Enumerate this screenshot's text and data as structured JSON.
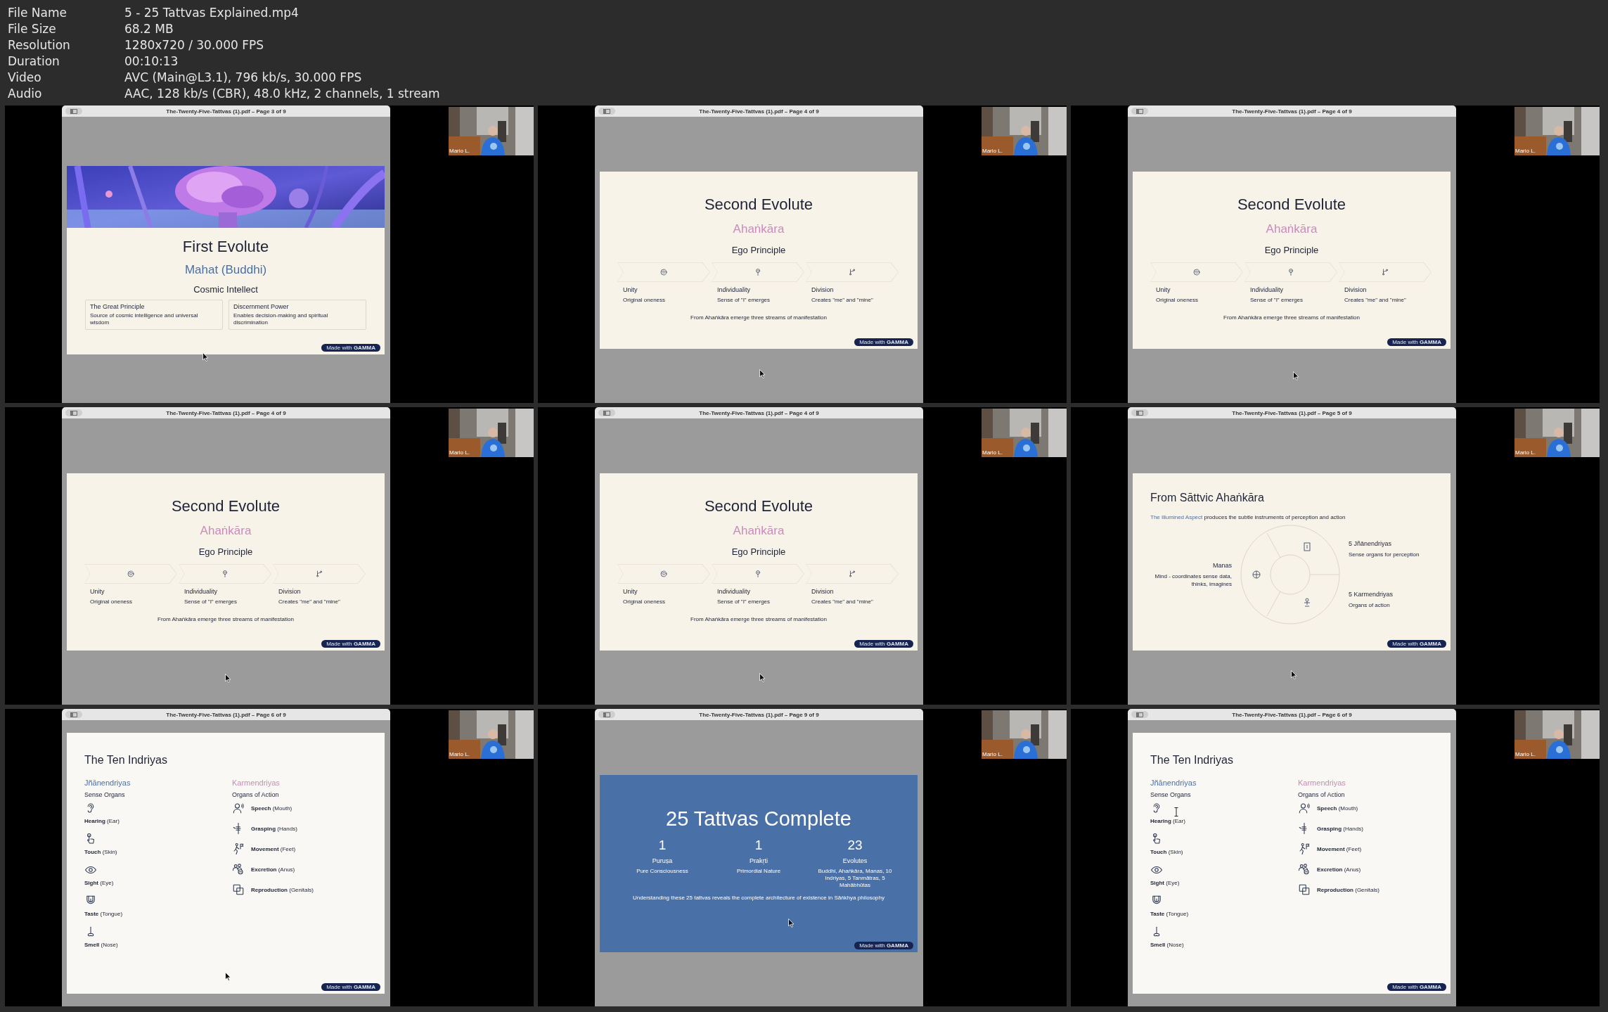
{
  "header": {
    "fields": [
      {
        "label": "File Name",
        "value": "5 - 25 Tattvas Explained.mp4"
      },
      {
        "label": "File Size",
        "value": "68.2 MB"
      },
      {
        "label": "Resolution",
        "value": "1280x720 / 30.000 FPS"
      },
      {
        "label": "Duration",
        "value": "00:10:13"
      },
      {
        "label": "Video",
        "value": "AVC (Main@L3.1), 796 kb/s, 30.000 FPS"
      },
      {
        "label": "Audio",
        "value": "AAC, 128 kb/s (CBR), 48.0 kHz, 2 channels, 1 stream"
      }
    ]
  },
  "frames": [
    {
      "window_title": "The-Twenty-Five-Tattvas (1).pdf – Page 3 of 9",
      "webcam_name": "Mario L.",
      "slide": {
        "kind": "hero",
        "title": "First Evolute",
        "subtitle": "Mahat (Buddhi)",
        "heading": "Cosmic Intellect",
        "cards": [
          {
            "title": "The Great Principle",
            "text": "Source of cosmic intelligence and universal wisdom"
          },
          {
            "title": "Discernment Power",
            "text": "Enables decision-making and spiritual discrimination"
          }
        ],
        "badge": "Made with **GAMMA**"
      }
    },
    {
      "window_title": "The-Twenty-Five-Tattvas (1).pdf – Page 4 of 9",
      "webcam_name": "Mario L.",
      "slide": {
        "kind": "evolute",
        "title": "Second Evolute",
        "subtitle": "Ahaṅkāra",
        "heading": "Ego Principle",
        "steps": [
          {
            "label": "Unity",
            "text": "Original oneness"
          },
          {
            "label": "Individuality",
            "text": "Sense of \"I\" emerges"
          },
          {
            "label": "Division",
            "text": "Creates \"me\" and \"mine\""
          }
        ],
        "caption": "From Ahaṅkāra emerge three streams of manifestation",
        "badge": "Made with **GAMMA**"
      }
    },
    {
      "window_title": "The-Twenty-Five-Tattvas (1).pdf – Page 4 of 9",
      "webcam_name": "Mario L.",
      "slide": {
        "kind": "evolute",
        "title": "Second Evolute",
        "subtitle": "Ahaṅkāra",
        "heading": "Ego Principle",
        "steps": [
          {
            "label": "Unity",
            "text": "Original oneness"
          },
          {
            "label": "Individuality",
            "text": "Sense of \"I\" emerges"
          },
          {
            "label": "Division",
            "text": "Creates \"me\" and \"mine\""
          }
        ],
        "caption": "From Ahaṅkāra emerge three streams of manifestation",
        "badge": "Made with **GAMMA**"
      }
    },
    {
      "window_title": "The-Twenty-Five-Tattvas (1).pdf – Page 4 of 9",
      "webcam_name": "Mario L.",
      "slide": {
        "kind": "evolute",
        "title": "Second Evolute",
        "subtitle": "Ahaṅkāra",
        "heading": "Ego Principle",
        "steps": [
          {
            "label": "Unity",
            "text": "Original oneness"
          },
          {
            "label": "Individuality",
            "text": "Sense of \"I\" emerges"
          },
          {
            "label": "Division",
            "text": "Creates \"me\" and \"mine\""
          }
        ],
        "caption": "From Ahaṅkāra emerge three streams of manifestation",
        "badge": "Made with **GAMMA**"
      }
    },
    {
      "window_title": "The-Twenty-Five-Tattvas (1).pdf – Page 4 of 9",
      "webcam_name": "Mario L.",
      "slide": {
        "kind": "evolute",
        "title": "Second Evolute",
        "subtitle": "Ahaṅkāra",
        "heading": "Ego Principle",
        "steps": [
          {
            "label": "Unity",
            "text": "Original oneness"
          },
          {
            "label": "Individuality",
            "text": "Sense of \"I\" emerges"
          },
          {
            "label": "Division",
            "text": "Creates \"me\" and \"mine\""
          }
        ],
        "caption": "From Ahaṅkāra emerge three streams of manifestation",
        "badge": "Made with **GAMMA**"
      }
    },
    {
      "window_title": "The-Twenty-Five-Tattvas (1).pdf – Page 5 of 9",
      "webcam_name": "Mario L.",
      "slide": {
        "kind": "diagram",
        "title": "From Sāttvic Ahaṅkāra",
        "intro_lead": "The Illumined Aspect",
        "intro_rest": "produces the subtle instruments of perception and action",
        "left": {
          "title": "Manas",
          "text": "Mind - coordinates sense data, thinks, imagines"
        },
        "right": [
          {
            "title": "5 Jñānendriyas",
            "text": "Sense organs for perception"
          },
          {
            "title": "5 Karmendriyas",
            "text": "Organs of action"
          }
        ],
        "badge": "Made with **GAMMA**"
      }
    },
    {
      "window_title": "The-Twenty-Five-Tattvas (1).pdf – Page 6 of 9",
      "webcam_name": "Mario L.",
      "slide": {
        "kind": "list",
        "title": "The Ten Indriyas",
        "columns": [
          {
            "kind": "stacked",
            "heading": "Jñānendriyas",
            "color": "#4a6fa5",
            "subheading": "Sense Organs",
            "items": [
              "**Hearing** (Ear)",
              "**Touch** (Skin)",
              "**Sight** (Eye)",
              "**Taste** (Tongue)",
              "**Smell** (Nose)"
            ]
          },
          {
            "kind": "inline",
            "heading": "Karmendriyas",
            "color": "#c98bb9",
            "subheading": "Organs of Action",
            "items": [
              "**Speech** (Mouth)",
              "**Grasping** (Hands)",
              "**Movement** (Feet)",
              "**Excretion** (Anus)",
              "**Reproduction** (Genitals)"
            ]
          }
        ],
        "badge": "Made with **GAMMA**"
      }
    },
    {
      "window_title": "The-Twenty-Five-Tattvas (1).pdf – Page 9 of 9",
      "webcam_name": "Mario L.",
      "slide": {
        "kind": "summary",
        "title": "25 Tattvas Complete",
        "stats": [
          {
            "number": "1",
            "label": "Puruṣa",
            "text": "Pure Consciousness"
          },
          {
            "number": "1",
            "label": "Prakṛti",
            "text": "Primordial Nature"
          },
          {
            "number": "23",
            "label": "Evolutes",
            "text": "Buddhi, Ahaṅkāra, Manas, 10 Indriyas, 5 Tanmātras, 5 Mahābhūtas"
          }
        ],
        "caption": "Understanding these 25 tattvas reveals the complete architecture of existence in Sāṅkhya philosophy",
        "badge": "Made with **GAMMA**"
      }
    },
    {
      "window_title": "The-Twenty-Five-Tattvas (1).pdf – Page 6 of 9",
      "webcam_name": "Mario L.",
      "slide": {
        "kind": "list",
        "title": "The Ten Indriyas",
        "columns": [
          {
            "kind": "stacked",
            "heading": "Jñānendriyas",
            "color": "#4a6fa5",
            "subheading": "Sense Organs",
            "items": [
              "**Hearing** (Ear)",
              "**Touch** (Skin)",
              "**Sight** (Eye)",
              "**Taste** (Tongue)",
              "**Smell** (Nose)"
            ]
          },
          {
            "kind": "inline",
            "heading": "Karmendriyas",
            "color": "#c98bb9",
            "subheading": "Organs of Action",
            "items": [
              "**Speech** (Mouth)",
              "**Grasping** (Hands)",
              "**Movement** (Feet)",
              "**Excretion** (Anus)",
              "**Reproduction** (Genitals)"
            ]
          }
        ],
        "badge": "Made with **GAMMA**"
      }
    }
  ]
}
